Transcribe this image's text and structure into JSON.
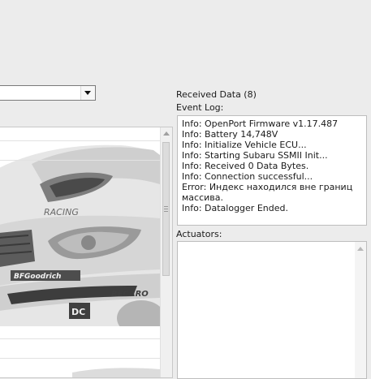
{
  "received_data": "Received Data (8)",
  "event_log": {
    "label": "Event Log:",
    "lines": [
      "Info: OpenPort Firmware v1.17.487",
      "Info: Battery 14,748V",
      "Info: Initialize Vehicle ECU...",
      "Info: Starting Subaru SSMII Init...",
      "Info: Received 0 Data Bytes.",
      "Info: Connection successful...",
      "Error: Индекс находился вне границ массива.",
      "Info: Datalogger Ended."
    ]
  },
  "actuators": {
    "label": "Actuators:"
  },
  "car_image": {
    "logos": [
      "BFGoodrich",
      "RECARO",
      "DC"
    ]
  }
}
